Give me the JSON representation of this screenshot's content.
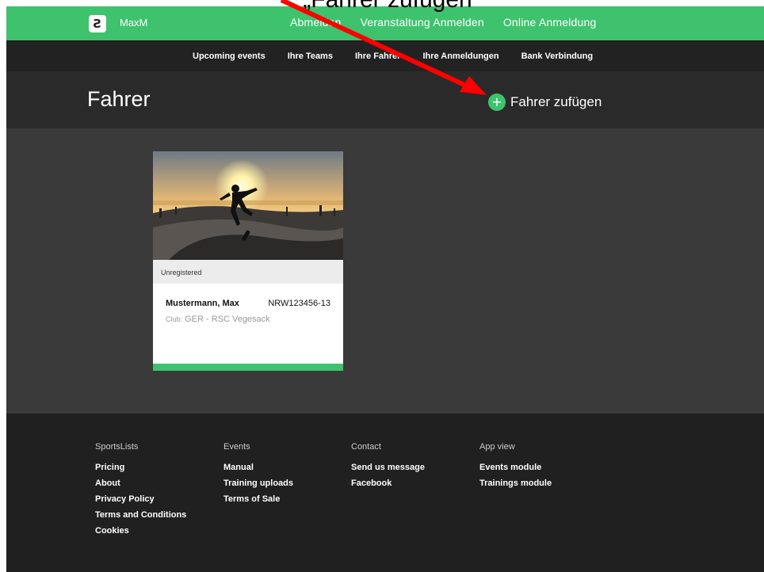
{
  "caption": "„Fahrer zufügen“",
  "colors": {
    "accent": "#3ec26e",
    "arrow": "#ff0000"
  },
  "navbar": {
    "brand_icon": "logo-icon",
    "brand_glyph": "Ƨ",
    "brand_name": "MaxM",
    "links": [
      "Abmelden",
      "Veranstaltung Anmelden",
      "Online Anmeldung"
    ]
  },
  "subnav": {
    "links": [
      "Upcoming events",
      "Ihre Teams",
      "Ihre Fahrer",
      "Ihre Anmeldungen",
      "Bank Verbindung"
    ]
  },
  "header": {
    "title": "Fahrer",
    "add_icon": "plus-icon",
    "add_glyph": "+",
    "add_label": "Fahrer zufügen"
  },
  "card": {
    "status": "Unregistered",
    "name": "Mustermann, Max",
    "id": "NRW123456-13",
    "club_prefix": "Club:",
    "club": "GER - RSC Vegesack"
  },
  "footer": {
    "columns": [
      {
        "heading": "SportsLists",
        "links": [
          "Pricing",
          "About",
          "Privacy Policy",
          "Terms and Conditions",
          "Cookies"
        ]
      },
      {
        "heading": "Events",
        "links": [
          "Manual",
          "Training uploads",
          "Terms of Sale"
        ]
      },
      {
        "heading": "Contact",
        "links": [
          "Send us message",
          "Facebook"
        ]
      },
      {
        "heading": "App view",
        "links": [
          "Events module",
          "Trainings module"
        ]
      }
    ]
  }
}
